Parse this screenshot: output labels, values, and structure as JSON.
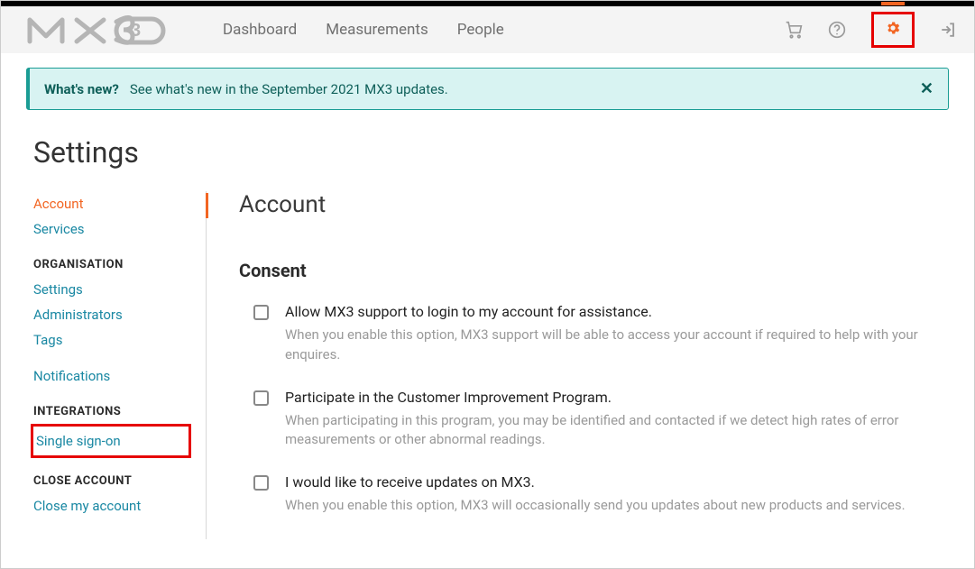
{
  "nav": {
    "dashboard": "Dashboard",
    "measurements": "Measurements",
    "people": "People"
  },
  "banner": {
    "title": "What's new?",
    "text": "See what's new in the September 2021 MX3 updates."
  },
  "page_title": "Settings",
  "sidebar": {
    "account": "Account",
    "services": "Services",
    "header_org": "ORGANISATION",
    "settings": "Settings",
    "administrators": "Administrators",
    "tags": "Tags",
    "notifications": "Notifications",
    "header_int": "INTEGRATIONS",
    "sso": "Single sign-on",
    "header_close": "CLOSE ACCOUNT",
    "close": "Close my account"
  },
  "content": {
    "section_title": "Account",
    "sub_title": "Consent",
    "options": [
      {
        "label": "Allow MX3 support to login to my account for assistance.",
        "desc": "When you enable this option, MX3 support will be able to access your account if required to help with your enquires."
      },
      {
        "label": "Participate in the Customer Improvement Program.",
        "desc": "When participating in this program, you may be identified and contacted if we detect high rates of error measurements or other abnormal readings."
      },
      {
        "label": "I would like to receive updates on MX3.",
        "desc": "When you enable this option, MX3 will occasionally send you updates about new products and services."
      }
    ]
  }
}
